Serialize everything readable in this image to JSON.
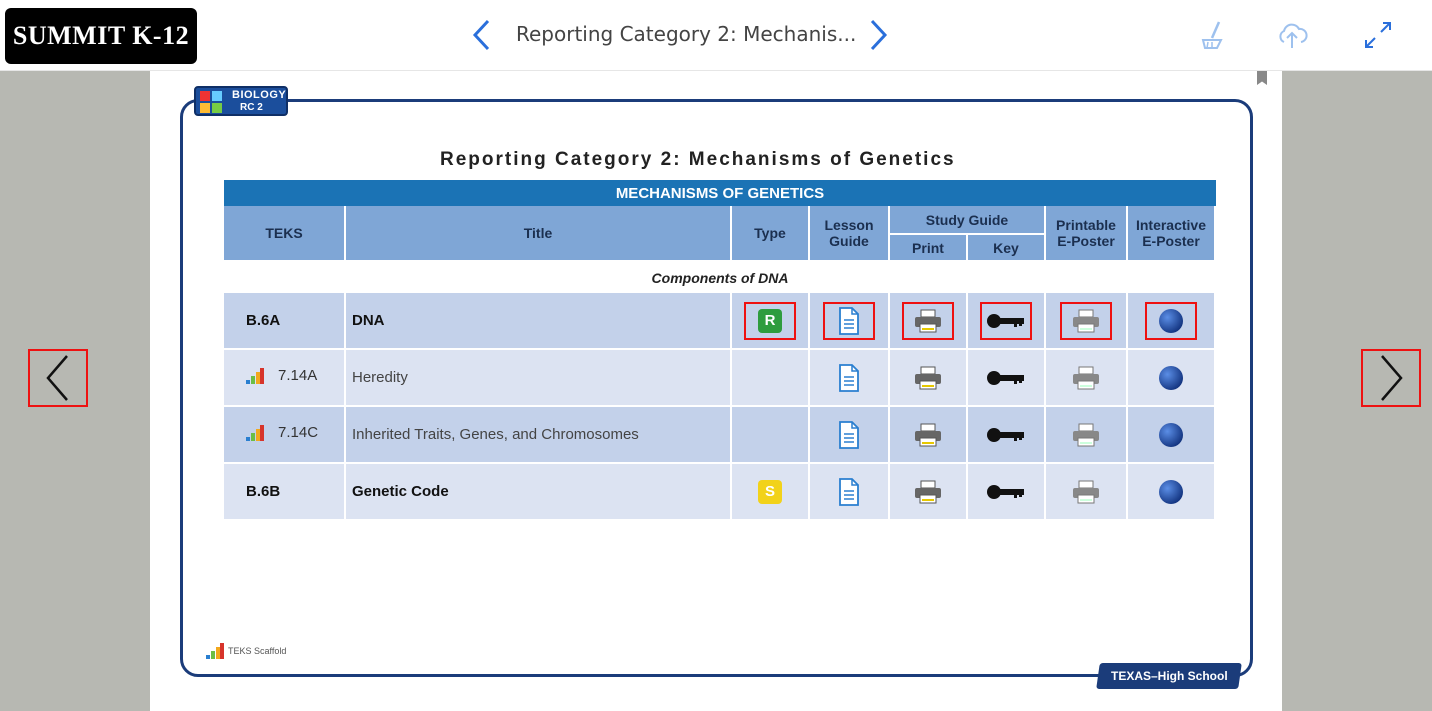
{
  "app": {
    "logo_text": "SUMMIT K-12"
  },
  "header": {
    "doc_title": "Reporting Category 2: Mechanis..."
  },
  "badge": {
    "line1": "BIOLOGY",
    "line2": "RC 2"
  },
  "page": {
    "heading": "Reporting Category 2: Mechanisms of Genetics",
    "banner": "MECHANISMS OF GENETICS",
    "columns": {
      "teks": "TEKS",
      "title": "Title",
      "type": "Type",
      "lesson_guide_1": "Lesson",
      "lesson_guide_2": "Guide",
      "study_guide": "Study Guide",
      "print": "Print",
      "key": "Key",
      "printable_1": "Printable",
      "printable_2": "E-Poster",
      "interactive_1": "Interactive",
      "interactive_2": "E-Poster"
    },
    "section": "Components of DNA",
    "rows": [
      {
        "teks": "B.6A",
        "title": "DNA",
        "type": "R"
      },
      {
        "teks": "7.14A",
        "title": "Heredity",
        "type": ""
      },
      {
        "teks": "7.14C",
        "title": "Inherited Traits, Genes, and Chromosomes",
        "type": ""
      },
      {
        "teks": "B.6B",
        "title": "Genetic Code",
        "type": "S"
      }
    ],
    "footer_scaffold": "TEKS Scaffold",
    "footer_badge": "TEXAS–High School"
  },
  "colors": {
    "type_r": "#2e9c3e",
    "type_s": "#f2d21a",
    "banner": "#1b73b5",
    "highlight": "#e11111"
  }
}
